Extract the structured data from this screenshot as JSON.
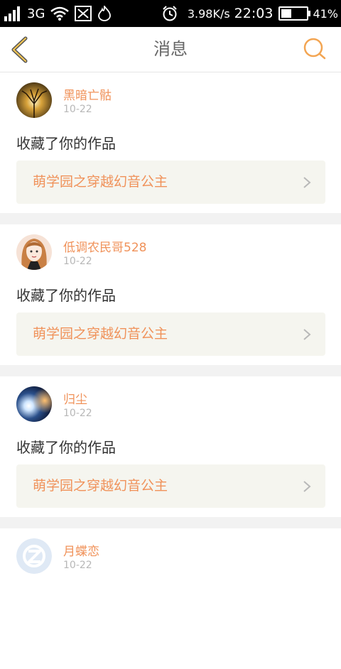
{
  "status_bar": {
    "network": "3G",
    "speed": "3.98K/s",
    "time": "22:03",
    "battery": "41%",
    "battery_level": 0.41
  },
  "header": {
    "title": "消息",
    "accent": "#f3a552"
  },
  "notifications": [
    {
      "user": "黑暗亡骷",
      "date": "10-22",
      "action": "收藏了你的作品",
      "work": "萌学园之穿越幻音公主",
      "avatar": "tree-avatar"
    },
    {
      "user": "低调农民哥528",
      "date": "10-22",
      "action": "收藏了你的作品",
      "work": "萌学园之穿越幻音公主",
      "avatar": "girl-avatar"
    },
    {
      "user": "归尘",
      "date": "10-22",
      "action": "收藏了你的作品",
      "work": "萌学园之穿越幻音公主",
      "avatar": "light-avatar"
    },
    {
      "user": "月蝶恋",
      "date": "10-22",
      "avatar": "default-avatar"
    }
  ],
  "colors": {
    "username": "#f0925a",
    "date": "#b7b7b7",
    "separator": "#f2f2f2",
    "work_box": "#f5f5ef"
  }
}
